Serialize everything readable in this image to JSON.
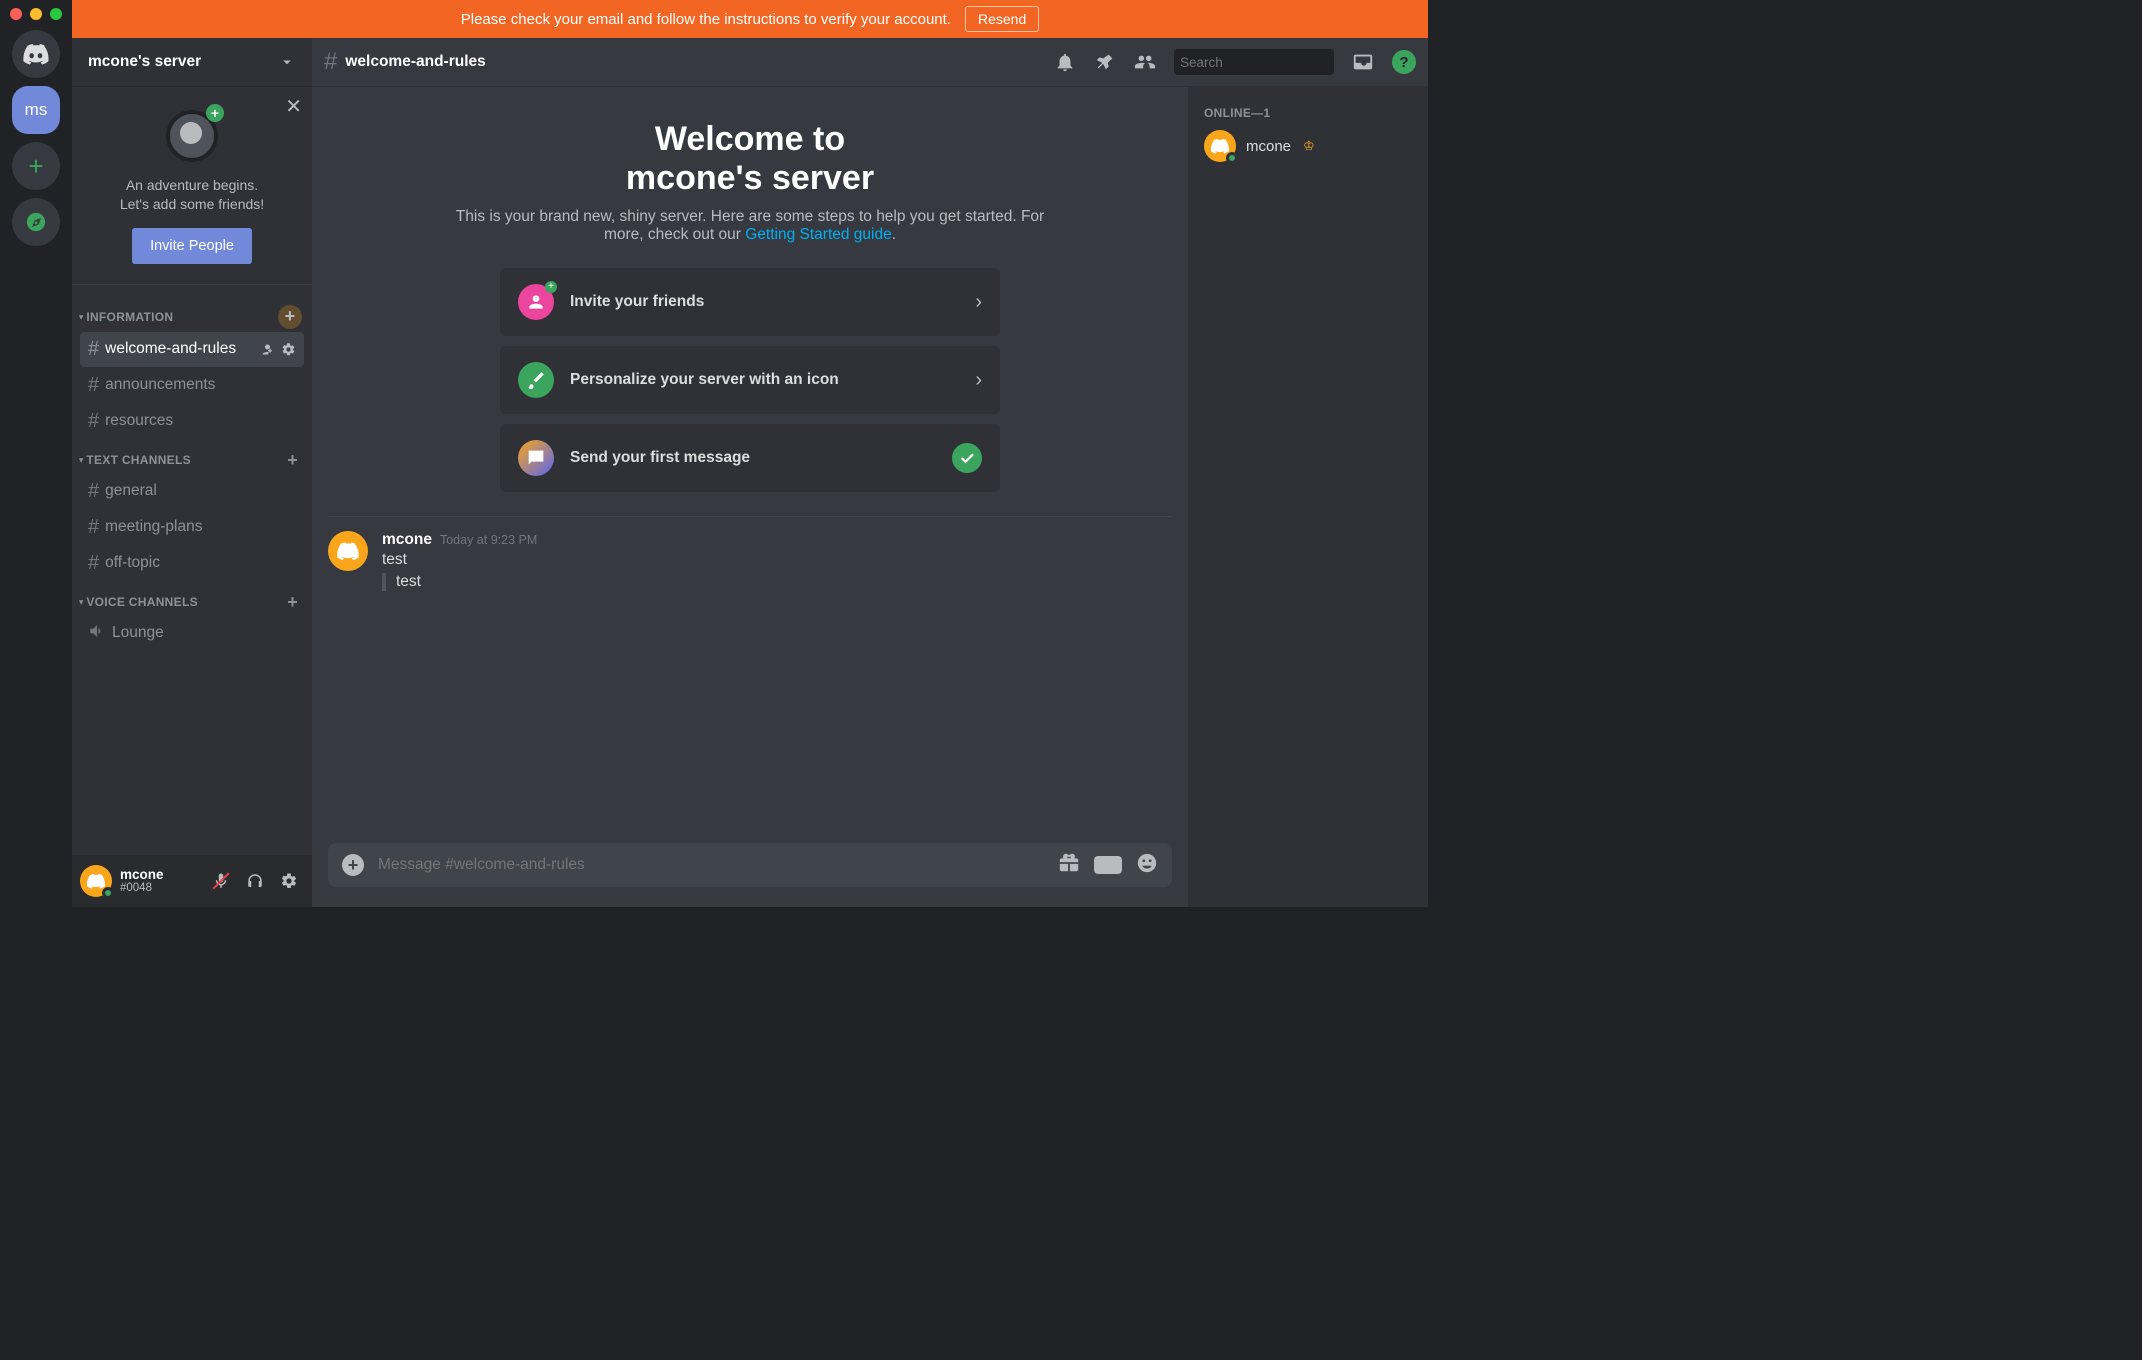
{
  "traffic_lights": {
    "close": "Close",
    "minimize": "Minimize",
    "zoom": "Zoom"
  },
  "notice": {
    "text": "Please check your email and follow the instructions to verify your account.",
    "button": "Resend"
  },
  "guild_rail": {
    "home": "Home",
    "selected_initials": "ms",
    "add_tooltip": "Add a Server",
    "explore_tooltip": "Explore Public Servers"
  },
  "server": {
    "name": "mcone's server"
  },
  "invite_card": {
    "line1": "An adventure begins.",
    "line2": "Let's add some friends!",
    "button": "Invite People",
    "close_tooltip": "Close"
  },
  "categories": [
    {
      "name": "INFORMATION",
      "add_highlight": true,
      "channels": [
        {
          "id": "welcome-and-rules",
          "name": "welcome-and-rules",
          "type": "text",
          "active": true,
          "show_tools": true
        },
        {
          "id": "announcements",
          "name": "announcements",
          "type": "text",
          "active": false
        },
        {
          "id": "resources",
          "name": "resources",
          "type": "text",
          "active": false
        }
      ]
    },
    {
      "name": "TEXT CHANNELS",
      "channels": [
        {
          "id": "general",
          "name": "general",
          "type": "text",
          "active": false
        },
        {
          "id": "meeting-plans",
          "name": "meeting-plans",
          "type": "text",
          "active": false
        },
        {
          "id": "off-topic",
          "name": "off-topic",
          "type": "text",
          "active": false
        }
      ]
    },
    {
      "name": "VOICE CHANNELS",
      "channels": [
        {
          "id": "lounge",
          "name": "Lounge",
          "type": "voice",
          "active": false
        }
      ]
    }
  ],
  "user_panel": {
    "name": "mcone",
    "tag": "#0048",
    "mute_tooltip": "Unmute",
    "deafen_tooltip": "Deafen",
    "settings_tooltip": "User Settings"
  },
  "chat_header": {
    "channel": "welcome-and-rules",
    "icons": {
      "bell": "Notification Settings",
      "pin": "Pinned Messages",
      "members": "Member List",
      "inbox": "Inbox",
      "help": "Help"
    },
    "search_placeholder": "Search"
  },
  "welcome": {
    "title_line1": "Welcome to",
    "title_line2": "mcone's server",
    "subtitle_pre": "This is your brand new, shiny server. Here are some steps to help you get started. For more, check out our ",
    "subtitle_link": "Getting Started guide",
    "subtitle_post": "."
  },
  "onboarding_cards": [
    {
      "label": "Invite your friends",
      "icon": "invite",
      "done": false,
      "color": "#eb459e"
    },
    {
      "label": "Personalize your server with an icon",
      "icon": "brush",
      "done": false,
      "color": "#3ba55d"
    },
    {
      "label": "Send your first message",
      "icon": "chat",
      "done": true,
      "color": "#5865f2"
    }
  ],
  "messages": [
    {
      "author": "mcone",
      "timestamp": "Today at 9:23 PM",
      "content": "test",
      "quote": "test"
    }
  ],
  "composer": {
    "placeholder": "Message #welcome-and-rules",
    "attach_tooltip": "Upload a file",
    "gift_tooltip": "Gift Nitro",
    "gif_label": "GIF",
    "emoji_tooltip": "Emoji"
  },
  "members": {
    "group": "ONLINE—1",
    "items": [
      {
        "name": "mcone",
        "owner": true
      }
    ]
  }
}
